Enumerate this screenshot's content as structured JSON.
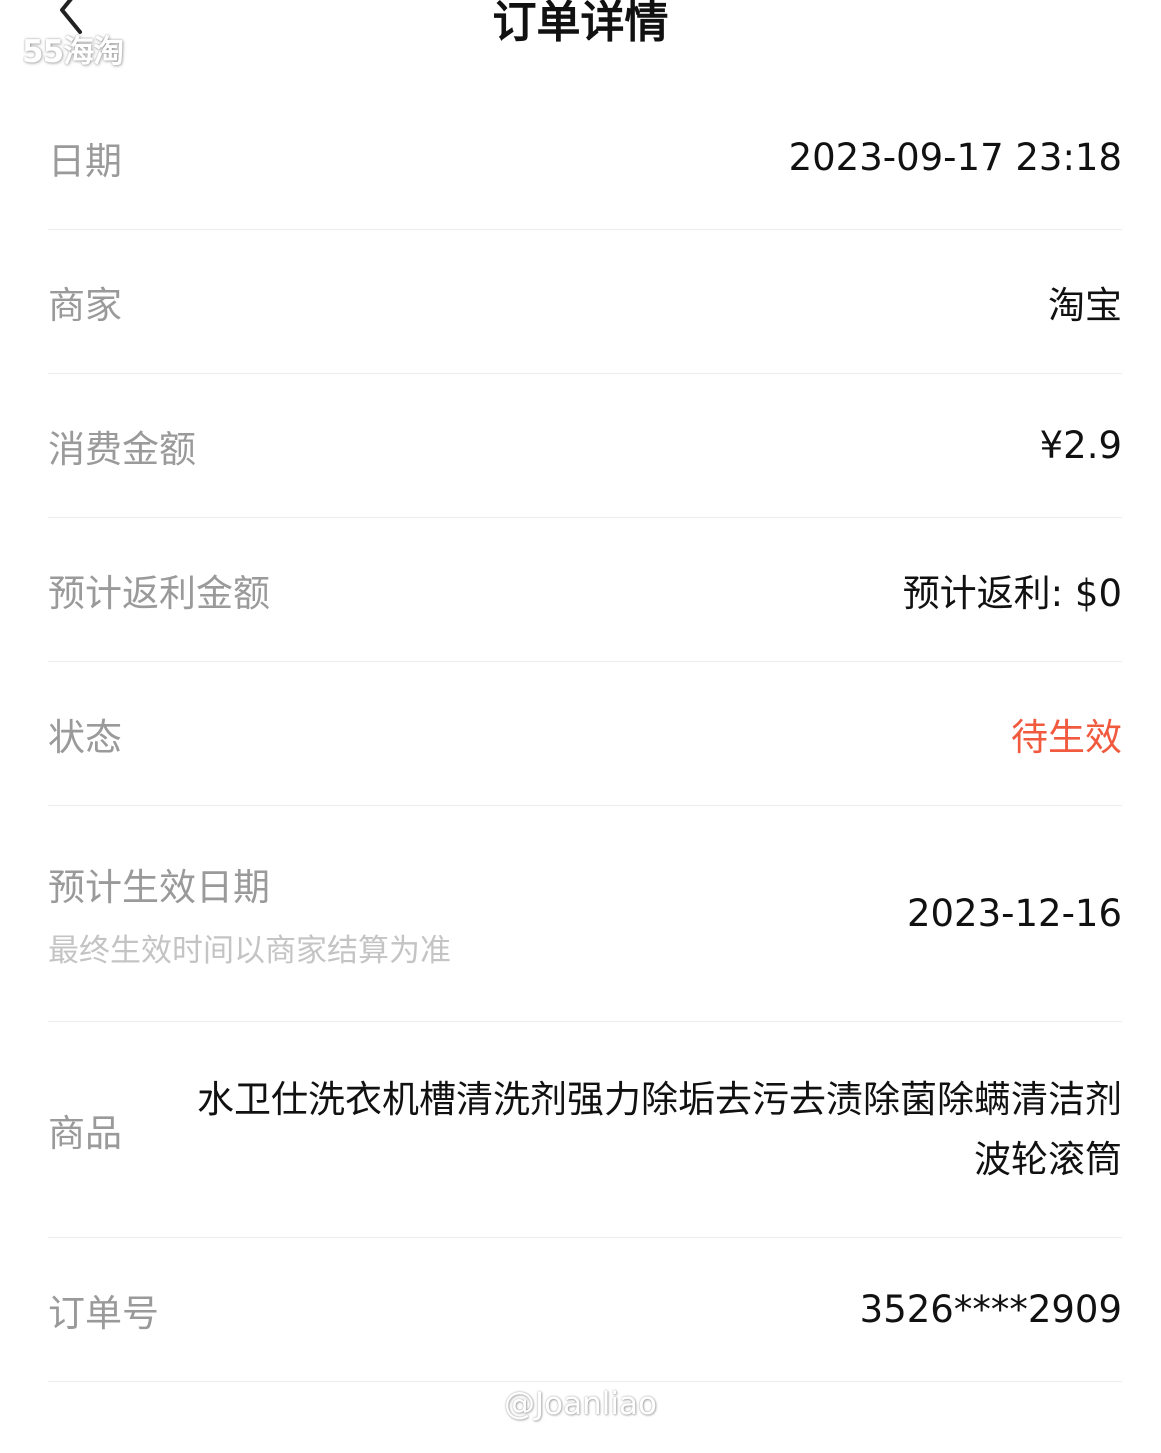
{
  "header": {
    "title": "订单详情",
    "back_icon": "chevron-left-icon"
  },
  "watermarks": {
    "top": "55海淘",
    "bottom": "@Joanliao"
  },
  "order": {
    "date": {
      "label": "日期",
      "value": "2023-09-17 23:18"
    },
    "merchant": {
      "label": "商家",
      "value": "淘宝"
    },
    "amount": {
      "label": "消费金额",
      "value": "¥2.9"
    },
    "rebate": {
      "label": "预计返利金额",
      "value": "预计返利: $0"
    },
    "status": {
      "label": "状态",
      "value": "待生效",
      "color": "#f15a3f"
    },
    "effective_date": {
      "label": "预计生效日期",
      "note": "最终生效时间以商家结算为准",
      "value": "2023-12-16"
    },
    "product": {
      "label": "商品",
      "value": "水卫仕洗衣机槽清洗剂强力除垢去污去渍除菌除螨清洁剂波轮滚筒"
    },
    "order_no": {
      "label": "订单号",
      "value": "3526****2909"
    }
  }
}
